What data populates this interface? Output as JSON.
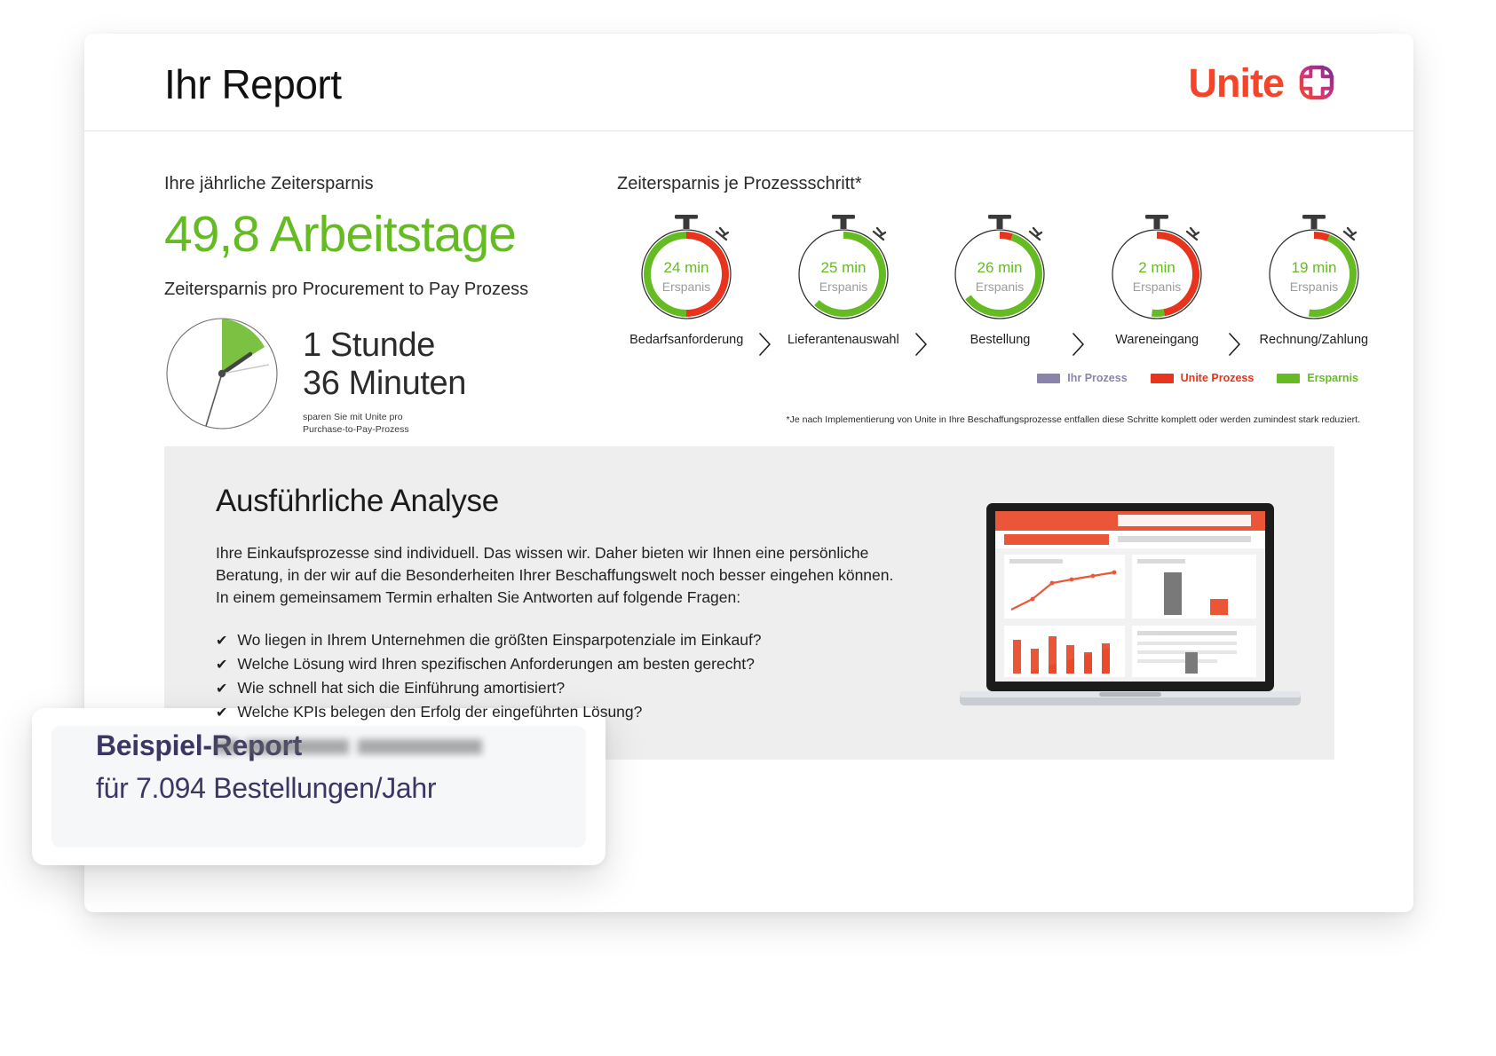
{
  "header": {
    "title": "Ihr Report",
    "brand_word": "Unite",
    "brand_mark_icon": "unite-plus-logo-icon",
    "brand_color": "#f4452a",
    "brand_mark_color_start": "#7b2d8e",
    "brand_mark_color_end": "#f4452a"
  },
  "savings": {
    "kicker": "Ihre jährliche Zeitersparnis",
    "headline_value": "49,8 Arbeitstage",
    "headline_color": "#64bb22",
    "sub_kicker": "Zeitersparnis pro Procurement to Pay Prozess",
    "clock": {
      "line1": "1 Stunde",
      "line2": "36 Minuten",
      "note_line1": "sparen Sie mit Unite pro",
      "note_line2": "Purchase-to-Pay-Prozess",
      "wedge_color": "#7bc242"
    }
  },
  "process": {
    "title": "Zeitersparnis je Prozessschritt*",
    "unit_suffix": "Erspanis",
    "footnote": "*Je nach Implementierung von Unite in Ihre Beschaffungsprozesse entfallen diese Schritte komplett oder werden zumindest stark reduziert.",
    "legend": [
      {
        "label": "Ihr Prozess",
        "color": "#8a84ad"
      },
      {
        "label": "Unite Prozess",
        "color": "#e8341c"
      },
      {
        "label": "Ersparnis",
        "color": "#64bb22"
      }
    ],
    "arrow_icon": "chevron-right-icon",
    "steps": [
      {
        "label": "Bedarfsanforderung",
        "value": "24 min",
        "unit": "Erspanis",
        "green_fraction": 0.5,
        "red_fraction": 0.5
      },
      {
        "label": "Lieferantenauswahl",
        "value": "25 min",
        "unit": "Erspanis",
        "green_fraction": 0.62,
        "red_fraction": 0.0
      },
      {
        "label": "Bestellung",
        "value": "26 min",
        "unit": "Erspanis",
        "green_fraction": 0.6,
        "red_fraction": 0.05
      },
      {
        "label": "Wareneingang",
        "value": "2 min",
        "unit": "Erspanis",
        "green_fraction": 0.05,
        "red_fraction": 0.47
      },
      {
        "label": "Rechnung/Zahlung",
        "value": "19 min",
        "unit": "Erspanis",
        "green_fraction": 0.46,
        "red_fraction": 0.06
      }
    ]
  },
  "chart_data": {
    "type": "bar",
    "title": "Zeitersparnis je Prozessschritt*",
    "categories": [
      "Bedarfsanforderung",
      "Lieferantenauswahl",
      "Bestellung",
      "Wareneingang",
      "Rechnung/Zahlung"
    ],
    "series": [
      {
        "name": "Ersparnis",
        "values": [
          24,
          25,
          26,
          2,
          19
        ],
        "unit": "min",
        "color": "#64bb22"
      }
    ],
    "legend": [
      "Ihr Prozess",
      "Unite Prozess",
      "Ersparnis"
    ],
    "ylabel": "min",
    "annotations": [
      "Ihre jährliche Zeitersparnis: 49,8 Arbeitstage",
      "Zeitersparnis pro Procurement to Pay Prozess: 1 Stunde 36 Minuten"
    ]
  },
  "analysis": {
    "title": "Ausführliche Analyse",
    "paragraph": "Ihre Einkaufsprozesse sind individuell. Das wissen wir. Daher bieten wir Ihnen eine persönliche Beratung, in der wir auf die Besonderheiten Ihrer Beschaffungswelt noch besser eingehen können. In einem gemeinsamem Termin erhalten Sie Antworten auf folgende Fragen:",
    "check_icon": "check-icon",
    "bullets": [
      "Wo liegen in Ihrem Unternehmen die größten Einsparpotenziale im Einkauf?",
      "Welche Lösung wird Ihren spezifischen Anforderungen am besten gerecht?",
      "Wie schnell hat sich die Einführung amortisiert?",
      "Welche KPIs belegen den Erfolg der eingeführten Lösung?"
    ],
    "laptop_icon": "laptop-dashboard-illustration"
  },
  "overlay": {
    "title": "Beispiel-Report",
    "subtitle": "für 7.094 Bestellungen/Jahr",
    "text_color": "#3b3663"
  }
}
